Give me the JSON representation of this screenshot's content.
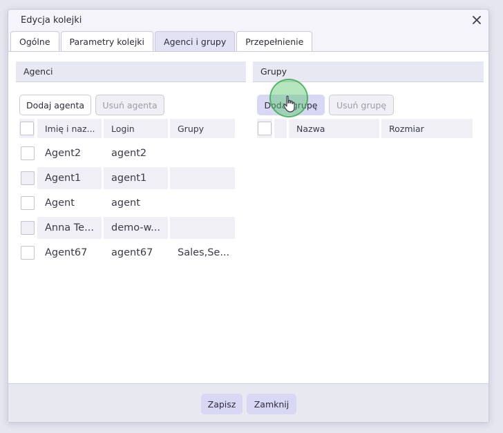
{
  "dialog": {
    "title": "Edycja kolejki",
    "close_icon": "close-icon"
  },
  "tabs": [
    {
      "label": "Ogólne"
    },
    {
      "label": "Parametry kolejki"
    },
    {
      "label": "Agenci i grupy",
      "active": true
    },
    {
      "label": "Przepełnienie"
    }
  ],
  "agents": {
    "title": "Agenci",
    "add_label": "Dodaj agenta",
    "remove_label": "Usuń agenta",
    "columns": [
      "Imię i naz...",
      "Login",
      "Grupy"
    ],
    "rows": [
      {
        "name": "Agent2",
        "login": "agent2",
        "groups": ""
      },
      {
        "name": "Agent1",
        "login": "agent1",
        "groups": ""
      },
      {
        "name": "Agent",
        "login": "agent",
        "groups": ""
      },
      {
        "name": "Anna Te...",
        "login": "demo-w...",
        "groups": ""
      },
      {
        "name": "Agent67",
        "login": "agent67",
        "groups": "Sales,Se..."
      }
    ]
  },
  "groups": {
    "title": "Grupy",
    "add_label": "Dodaj grupę",
    "remove_label": "Usuń grupę",
    "columns": [
      "Nazwa",
      "Rozmiar"
    ]
  },
  "footer": {
    "save_label": "Zapisz",
    "close_label": "Zamknij"
  },
  "colors": {
    "accent": "#d8d8f4",
    "cursor_highlight": "#5ac86e"
  }
}
